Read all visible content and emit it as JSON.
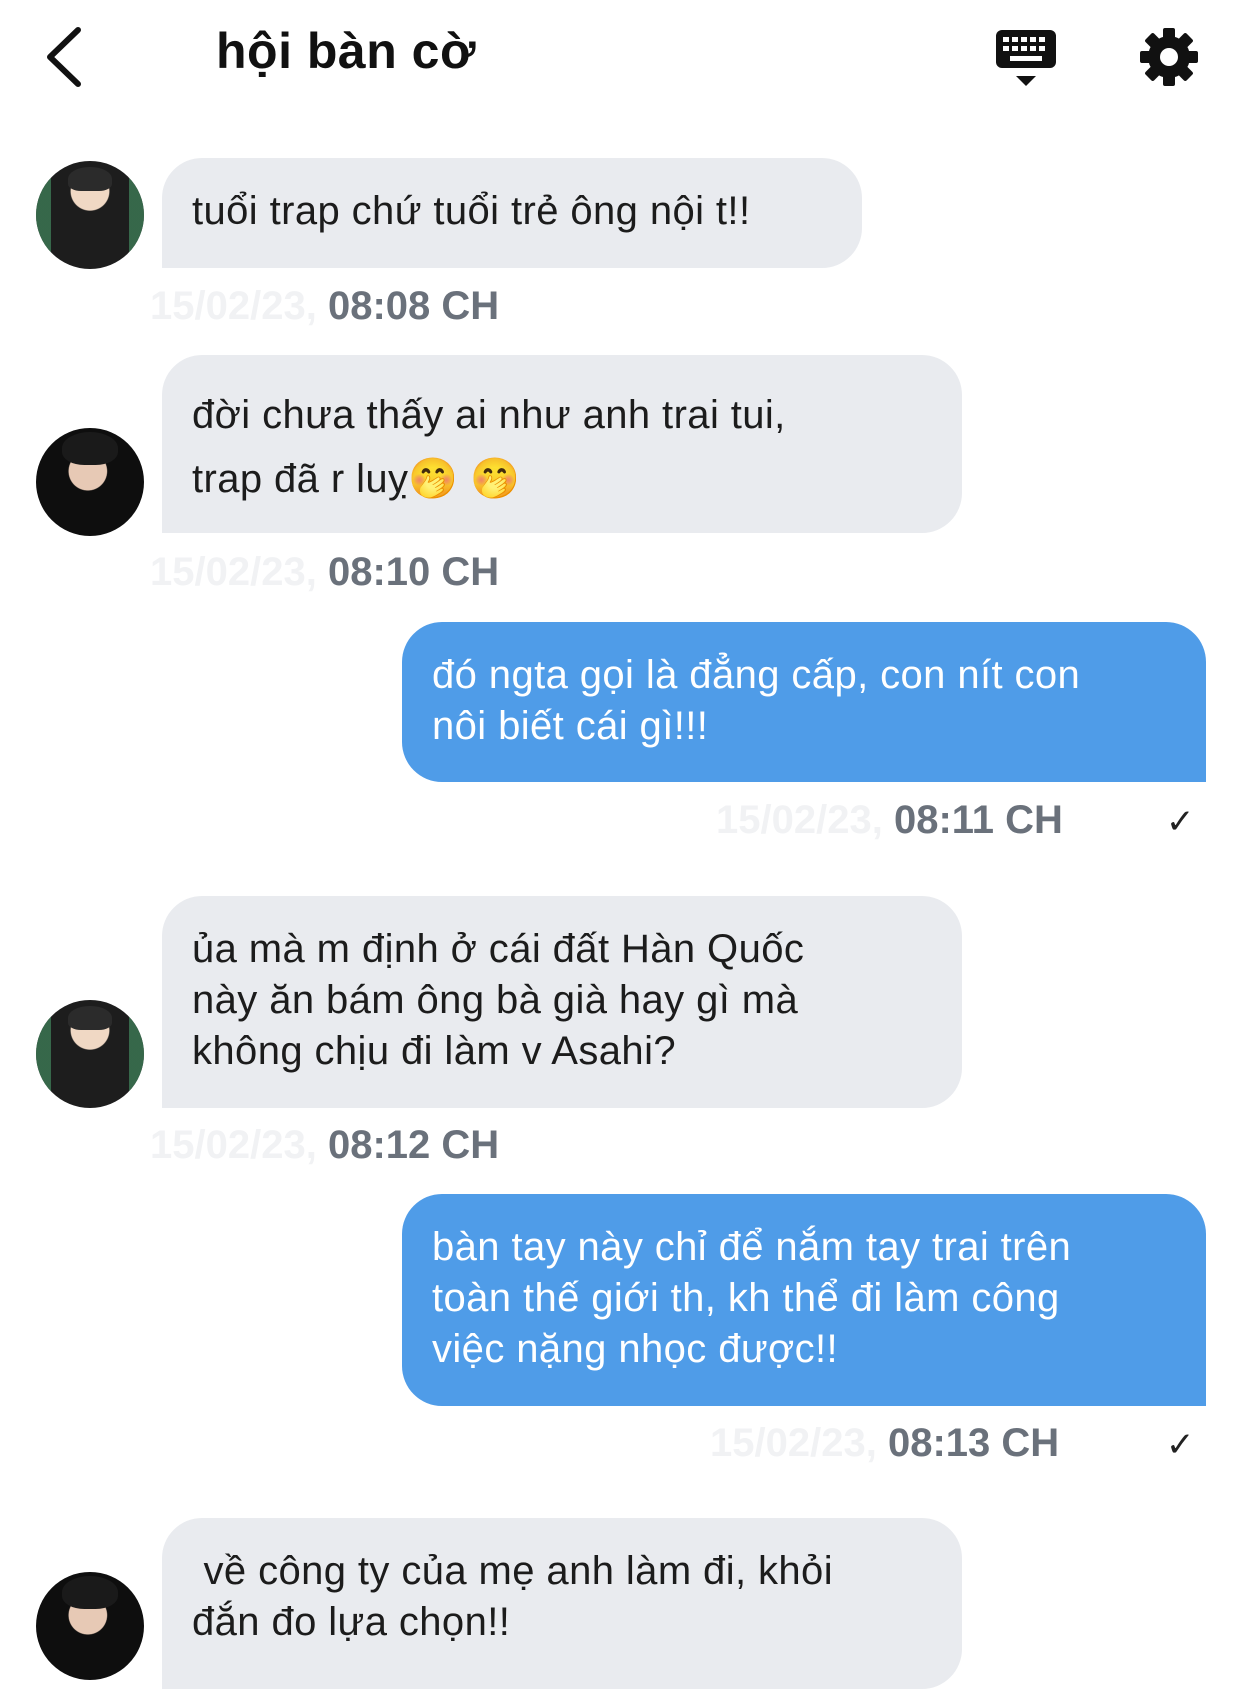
{
  "header": {
    "title": "hội bàn cờ",
    "back_icon": "back-chevron-icon",
    "keyboard_icon": "keyboard-icon",
    "settings_icon": "gear-icon"
  },
  "messages": [
    {
      "lines": [
        "tuổi trap chứ tuổi trẻ ông nội t!!"
      ],
      "faded_date": "15/02/23,",
      "time": "08:08 CH"
    },
    {
      "lines": [
        "đời chưa thấy ai như anh trai tui,",
        "trap đã r luỵ🤭 🤭"
      ],
      "faded_date": "15/02/23,",
      "time": "08:10 CH"
    },
    {
      "lines": [
        "đó ngta gọi là đẳng cấp, con nít con",
        "nôi biết cái gì!!!"
      ],
      "faded_date": "15/02/23,",
      "time": "08:11 CH",
      "status": "✓"
    },
    {
      "lines": [
        "ủa mà m định ở cái đất Hàn Quốc",
        "này ăn bám ông bà già hay gì mà",
        "không chịu đi làm v Asahi?"
      ],
      "faded_date": "15/02/23,",
      "time": "08:12 CH"
    },
    {
      "lines": [
        "bàn tay này chỉ để nắm tay trai trên",
        "toàn thế giới th, kh thể đi làm công",
        "việc nặng nhọc được!!"
      ],
      "faded_date": "15/02/23,",
      "time": "08:13 CH",
      "status": "✓"
    },
    {
      "lines": [
        " về công ty của mẹ anh làm đi, khỏi",
        "đắn đo lựa chọn!!"
      ]
    }
  ]
}
